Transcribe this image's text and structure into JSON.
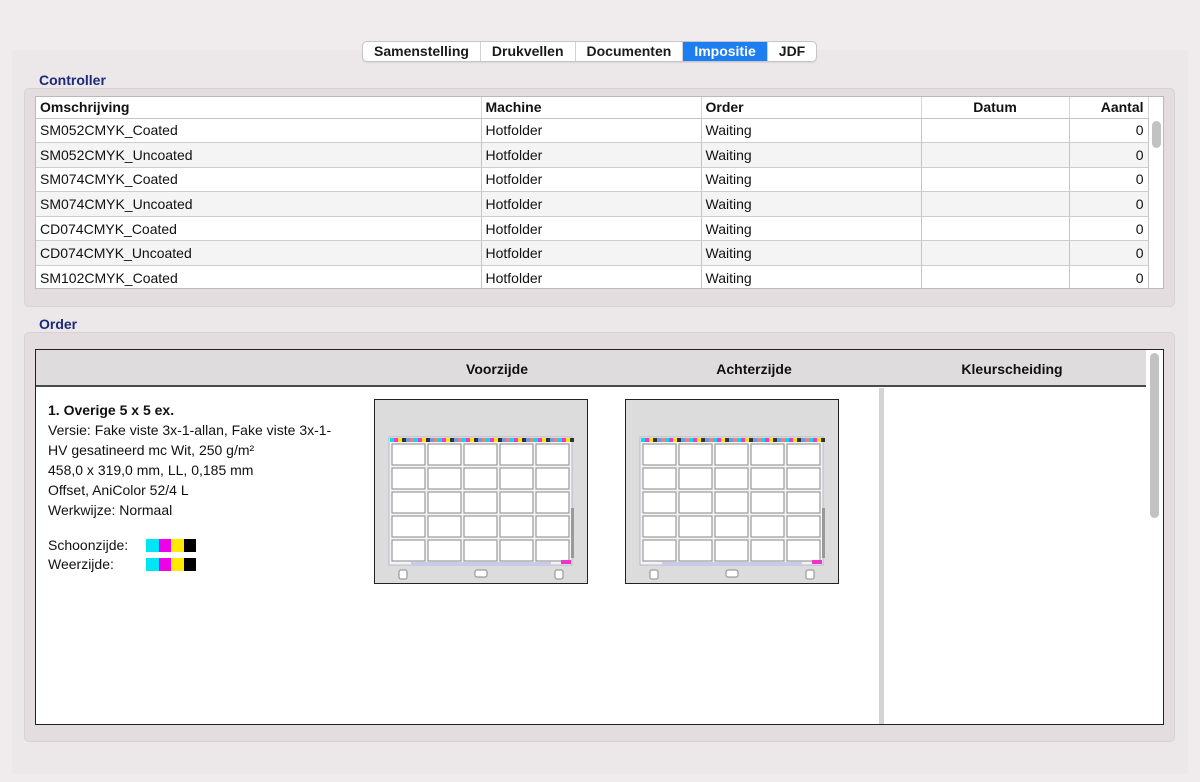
{
  "tabs": [
    {
      "label": "Samenstelling",
      "active": false
    },
    {
      "label": "Drukvellen",
      "active": false
    },
    {
      "label": "Documenten",
      "active": false
    },
    {
      "label": "Impositie",
      "active": true
    },
    {
      "label": "JDF",
      "active": false
    }
  ],
  "controller": {
    "section_label": "Controller",
    "columns": {
      "omschrijving": "Omschrijving",
      "machine": "Machine",
      "order": "Order",
      "datum": "Datum",
      "aantal": "Aantal"
    },
    "rows": [
      {
        "omschrijving": "SM052CMYK_Coated",
        "machine": "Hotfolder",
        "order": "Waiting",
        "datum": "",
        "aantal": "0"
      },
      {
        "omschrijving": "SM052CMYK_Uncoated",
        "machine": "Hotfolder",
        "order": "Waiting",
        "datum": "",
        "aantal": "0"
      },
      {
        "omschrijving": "SM074CMYK_Coated",
        "machine": "Hotfolder",
        "order": "Waiting",
        "datum": "",
        "aantal": "0"
      },
      {
        "omschrijving": "SM074CMYK_Uncoated",
        "machine": "Hotfolder",
        "order": "Waiting",
        "datum": "",
        "aantal": "0"
      },
      {
        "omschrijving": "CD074CMYK_Coated",
        "machine": "Hotfolder",
        "order": "Waiting",
        "datum": "",
        "aantal": "0"
      },
      {
        "omschrijving": "CD074CMYK_Uncoated",
        "machine": "Hotfolder",
        "order": "Waiting",
        "datum": "",
        "aantal": "0"
      },
      {
        "omschrijving": "SM102CMYK_Coated",
        "machine": "Hotfolder",
        "order": "Waiting",
        "datum": "",
        "aantal": "0"
      }
    ]
  },
  "order": {
    "section_label": "Order",
    "columns": {
      "voorzijde": "Voorzijde",
      "achterzijde": "Achterzijde",
      "kleurscheiding": "Kleurscheiding"
    },
    "item": {
      "title": "1. Overige 5 x 5 ex.",
      "lines": [
        "Versie: Fake viste 3x-1-allan, Fake viste 3x-1-",
        "HV gesatineerd mc Wit, 250 g/m²",
        "458,0 x 319,0 mm, LL, 0,185 mm",
        "Offset, AniColor 52/4 L",
        "Werkwijze: Normaal"
      ],
      "schoonzijde_label": "Schoonzijde:",
      "weerzijde_label": "Weerzijde:",
      "ink_colors": [
        "#00e5f5",
        "#ee00e8",
        "#ffea00",
        "#000000"
      ]
    }
  }
}
